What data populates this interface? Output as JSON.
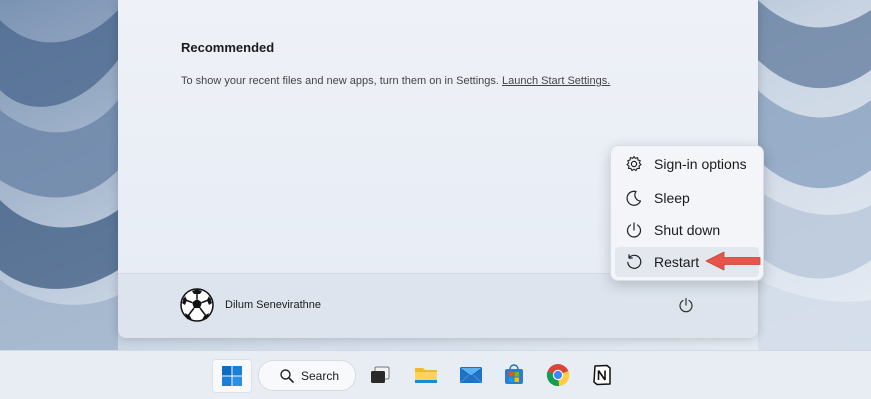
{
  "start_menu": {
    "recommended_title": "Recommended",
    "recommended_text": "To show your recent files and new apps, turn them on in Settings. ",
    "recommended_link": "Launch Start Settings.",
    "user_name": "Dilum Senevirathne"
  },
  "power_menu": {
    "items": [
      {
        "label": "Sign-in options",
        "icon": "gear-icon"
      },
      {
        "label": "Sleep",
        "icon": "moon-icon"
      },
      {
        "label": "Shut down",
        "icon": "power-icon"
      },
      {
        "label": "Restart",
        "icon": "restart-icon"
      }
    ],
    "highlighted": "Restart"
  },
  "taskbar": {
    "search_label": "Search",
    "apps": [
      "start-icon",
      "task-view-icon",
      "file-explorer-icon",
      "mail-icon",
      "store-icon",
      "chrome-icon",
      "notion-icon"
    ]
  },
  "colors": {
    "arrow": "#e5554a",
    "start_accent": "#0f6cbd"
  }
}
